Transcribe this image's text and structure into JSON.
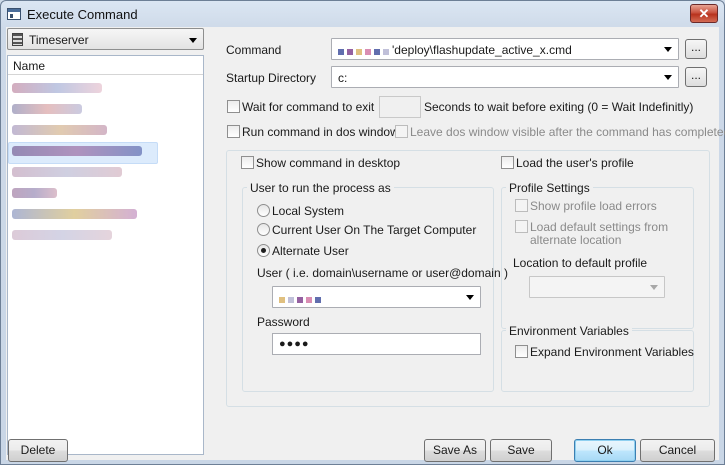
{
  "window": {
    "title": "Execute Command",
    "close_glyph": "✕"
  },
  "left_pane": {
    "dropdown_value": "Timeserver",
    "list_header": "Name",
    "items": [
      {
        "w": 90,
        "colors": [
          "#b06a8a",
          "#8b9acb",
          "#e0b0c0"
        ]
      },
      {
        "w": 70,
        "colors": [
          "#6e6e9e",
          "#d08a8a",
          "#a0a0c8"
        ]
      },
      {
        "w": 95,
        "colors": [
          "#8f7fb0",
          "#c8a070",
          "#b07a9a"
        ]
      },
      {
        "w": 130,
        "colors": [
          "#5a3a7a",
          "#8a4a8a",
          "#3a4a9a"
        ]
      },
      {
        "w": 110,
        "colors": [
          "#b08aa8",
          "#a8a8c8",
          "#c8a0b0"
        ]
      },
      {
        "w": 45,
        "colors": [
          "#8a5a8a",
          "#7a6aa0",
          "#c08aa0"
        ]
      },
      {
        "w": 125,
        "colors": [
          "#6a7ab0",
          "#c8a850",
          "#b070b0"
        ]
      },
      {
        "w": 100,
        "colors": [
          "#c0a0b8",
          "#b0b0d0",
          "#d0b0c0"
        ]
      }
    ]
  },
  "command": {
    "label": "Command",
    "value": "'deploy\\flashupdate_active_x.cmd",
    "browse_label": "..."
  },
  "startup_dir": {
    "label": "Startup Directory",
    "value": "c:",
    "browse_label": "..."
  },
  "wait": {
    "label": "Wait for command to exit",
    "seconds_label": "Seconds to wait before exiting (0 = Wait Indefinitly)",
    "seconds_value": ""
  },
  "dos": {
    "label": "Run command in dos window",
    "leave_visible_label": "Leave dos window visible after the command has completed"
  },
  "desktop": {
    "label": "Show command in desktop"
  },
  "user_profile": {
    "label": "Load the user's profile"
  },
  "run_as": {
    "legend": "User to run the process as",
    "options": [
      "Local System",
      "Current User On The Target Computer",
      "Alternate User"
    ],
    "selected": "Alternate User",
    "user_label": "User ( i.e. domain\\username or user@domain )",
    "user_value_colors": [
      "#d8b060",
      "#b0b0d0",
      "#7a3a8a",
      "#d070a0",
      "#3a4a9a"
    ],
    "password_label": "Password",
    "password_value": "●●●●"
  },
  "profile_settings": {
    "legend": "Profile Settings",
    "show_errors_label": "Show profile load errors",
    "load_default_label_1": "Load default settings from",
    "load_default_label_2": "alternate location",
    "location_label": "Location to default profile",
    "location_value": ""
  },
  "env_vars": {
    "legend": "Environment Variables",
    "expand_label": "Expand Environment Variables"
  },
  "buttons": {
    "delete": "Delete",
    "save_as": "Save As",
    "save": "Save",
    "ok": "Ok",
    "cancel": "Cancel"
  }
}
